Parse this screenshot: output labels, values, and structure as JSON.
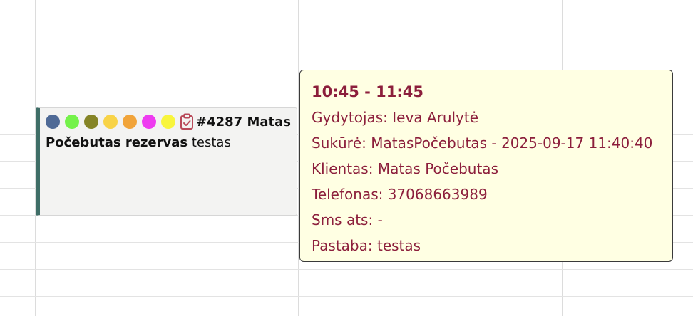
{
  "event": {
    "status_dots": [
      {
        "name": "slate-blue",
        "color": "#4f6a96"
      },
      {
        "name": "lime-green",
        "color": "#74f24a"
      },
      {
        "name": "olive",
        "color": "#858426"
      },
      {
        "name": "gold",
        "color": "#f8d347"
      },
      {
        "name": "orange",
        "color": "#f1a43a"
      },
      {
        "name": "magenta",
        "color": "#ee3bf0"
      },
      {
        "name": "yellow",
        "color": "#f8f53c"
      }
    ],
    "icon": "clipboard-check-icon",
    "icon_color": "#b94a5a",
    "title": "#4287 Matas",
    "name_bold": "Počebutas rezervas",
    "note": "testas",
    "accent_color": "#3f6e67"
  },
  "tooltip": {
    "time": "10:45 - 11:45",
    "doctor": "Gydytojas: Ieva Arulytė",
    "created": "Sukūrė: MatasPočebutas - 2025-09-17 11:40:40",
    "client": "Klientas: Matas Počebutas",
    "phone": "Telefonas: 37068663989",
    "sms": "Sms ats: -",
    "note": "Pastaba: testas",
    "text_color": "#8c1f3c",
    "background": "#ffffe3"
  }
}
